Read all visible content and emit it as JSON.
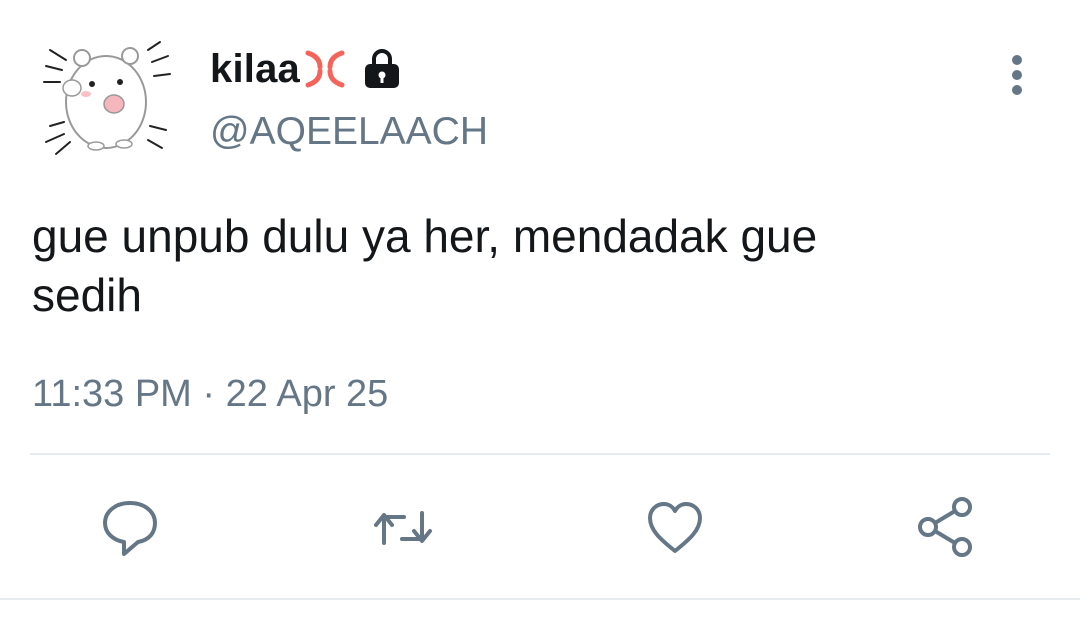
{
  "tweet": {
    "display_name": "kilaa",
    "handle": "@AQEELAACH",
    "text": "gue unpub dulu ya her, mendadak gue\nsedih",
    "time": "11:33 PM",
    "separator": "·",
    "date": "22 Apr 25"
  },
  "icons": {
    "avatar": "hamster-avatar",
    "name_emoji": "anger-symbol-icon",
    "protected": "lock-icon",
    "menu": "more-vertical-icon",
    "actions": [
      "reply-icon",
      "retweet-icon",
      "like-icon",
      "share-icon"
    ]
  },
  "colors": {
    "text": "#14171a",
    "secondary": "#657786",
    "divider": "#e6ecf0",
    "anger": "#f4645a"
  }
}
